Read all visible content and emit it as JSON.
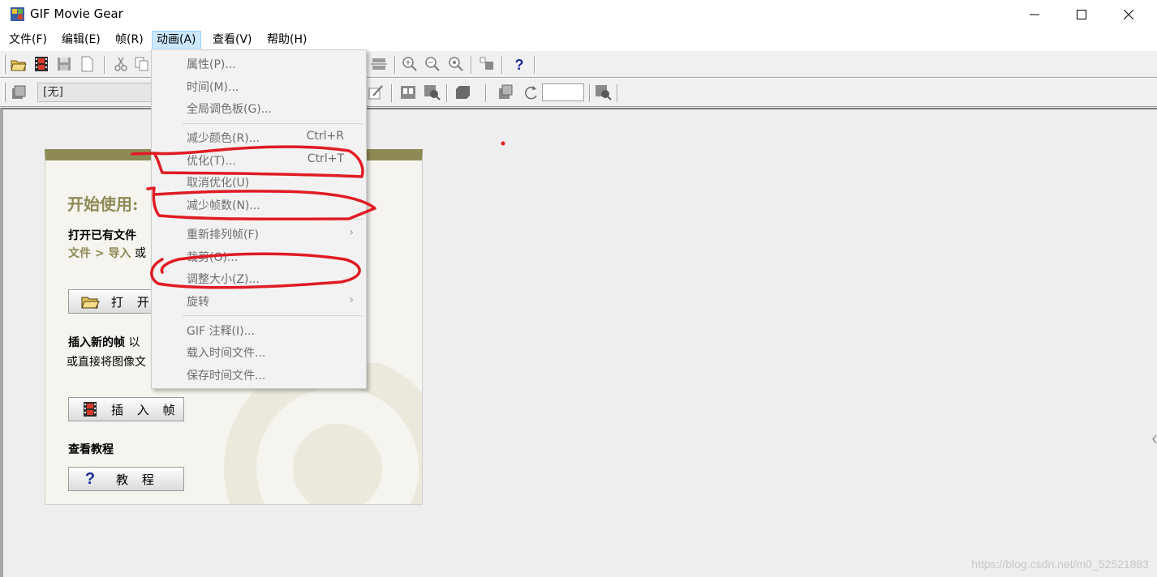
{
  "window": {
    "title": "GIF Movie Gear",
    "minimize_glyph": "—",
    "maximize_glyph": "☐",
    "close_glyph": "✕"
  },
  "menubar": [
    {
      "label": "文件(F)"
    },
    {
      "label": "编辑(E)"
    },
    {
      "label": "帧(R)"
    },
    {
      "label": "动画(A)",
      "active": true
    },
    {
      "label": "查看(V)"
    },
    {
      "label": "帮助(H)"
    }
  ],
  "toolbar2": {
    "frame_select_value": "[无]"
  },
  "animation_menu": {
    "items": [
      {
        "label": "属性(P)...",
        "shortcut": ""
      },
      {
        "label": "时间(M)...",
        "shortcut": ""
      },
      {
        "label": "全局调色板(G)...",
        "shortcut": ""
      },
      {
        "label": "减少颜色(R)...",
        "shortcut": "Ctrl+R"
      },
      {
        "label": "优化(T)...",
        "shortcut": "Ctrl+T"
      },
      {
        "label": "取消优化(U)",
        "shortcut": ""
      },
      {
        "label": "减少帧数(N)...",
        "shortcut": ""
      },
      {
        "label": "重新排列帧(F)",
        "shortcut": "",
        "submenu": true
      },
      {
        "label": "裁剪(O)...",
        "shortcut": ""
      },
      {
        "label": "调整大小(Z)...",
        "shortcut": ""
      },
      {
        "label": "旋转",
        "shortcut": "",
        "submenu": true
      },
      {
        "label": "GIF 注释(I)...",
        "shortcut": ""
      },
      {
        "label": "载入时间文件...",
        "shortcut": ""
      },
      {
        "label": "保存时间文件...",
        "shortcut": ""
      }
    ],
    "submenu_arrow": "›"
  },
  "start_panel": {
    "title": "开始使用:",
    "open_heading": "打开已有文件",
    "open_path_link": "文件 > 导入",
    "open_path_suffix": "或",
    "open_button": "打 开 文",
    "insert_heading": "插入新的帧",
    "insert_heading_suffix": "以",
    "insert_text": "或直接将图像文",
    "insert_button": "插 入 帧",
    "tutorial_heading": "查看教程",
    "tutorial_button": "教 程",
    "tutorial_glyph": "?"
  },
  "toolbar_icons": [
    "open-folder-icon",
    "film-strip-icon",
    "save-icon",
    "new-document-icon",
    "cut-icon",
    "copy-icon",
    "zoom-in-icon",
    "zoom-out-icon",
    "zoom-fit-icon",
    "frame-tool-icon",
    "help-icon"
  ],
  "annotation_color": "#e01b24",
  "watermark": "https://blog.csdn.net/m0_52521883"
}
